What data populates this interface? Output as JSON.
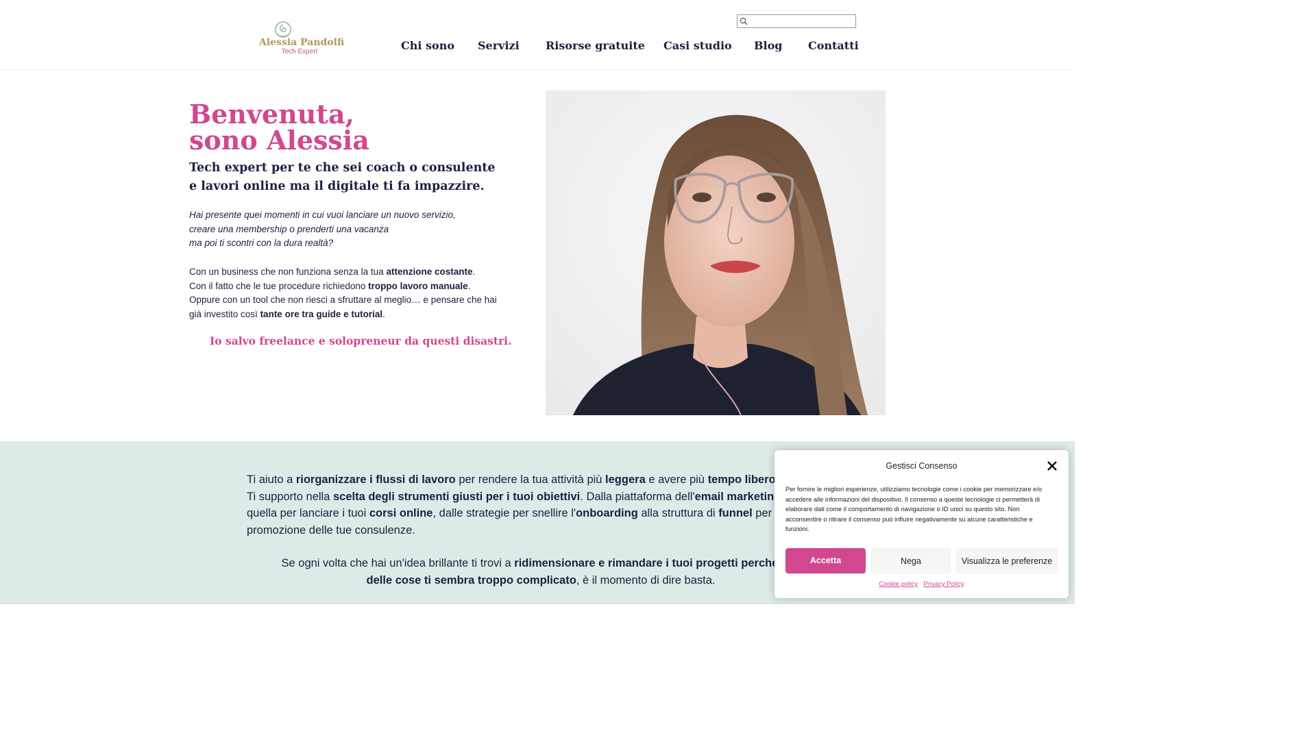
{
  "brand": {
    "name": "Alessia Pandolfi",
    "tagline": "Tech Expert",
    "gold": "#b5985a",
    "pink": "#d2478f",
    "navy": "#1b2040"
  },
  "search": {
    "placeholder": "",
    "value": ""
  },
  "nav": {
    "items": [
      "Chi sono",
      "Servizi",
      "Risorse gratuite",
      "Casi studio",
      "Blog",
      "Contatti"
    ]
  },
  "hero": {
    "title_line1": "Benvenuta,",
    "title_line2": "sono Alessia",
    "subtitle_line1": "Tech expert per te che sei coach o consulente",
    "subtitle_line2": "e lavori online ma il digitale ti fa impazzire.",
    "italic_line1": "Hai presente quei momenti in cui vuoi lanciare un nuovo servizio,",
    "italic_line2": "creare una membership o prenderti una vacanza",
    "italic_line3": "ma poi ti scontri con la dura realtà?",
    "body": {
      "l1a": "Con un business che non funziona senza la tua ",
      "l1b": "attenzione costante",
      "l1c": ".",
      "l2a": "Con il fatto che le tue procedure richiedono ",
      "l2b": "troppo lavoro manuale",
      "l2c": ".",
      "l3": "Oppure con un tool che non riesci a sfruttare al meglio… e pensare che hai",
      "l4a": "già investito così ",
      "l4b": "tante ore tra guide e tutorial",
      "l4c": "."
    },
    "tagline": "Io salvo freelance e solopreneur da questi disastri."
  },
  "band": {
    "p1": {
      "l1a": "Ti aiuto a ",
      "l1b": "riorganizzare i flussi di lavoro",
      "l1c": " per rendere la tua attività più ",
      "l1d": "leggera",
      "l1e": " e avere più ",
      "l1f": "tempo libero",
      "l2a": "Ti supporto nella ",
      "l2b": "scelta degli strumenti giusti per i tuoi obiettivi",
      "l2c": ". Dalla piattaforma dell'",
      "l2d": "email marketing",
      "l3a": "quella per lanciare i tuoi ",
      "l3b": "corsi online",
      "l3c": ", dalle strategie per snellire l'",
      "l3d": "onboarding",
      "l3e": " alla struttura di ",
      "l3f": "funnel",
      "l3g": " per",
      "l4": "promozione delle tue consulenze."
    },
    "p2": {
      "l1a": "Se ogni volta che hai un'idea brillante ti trovi a ",
      "l1b": "ridimensionare e rimandare i tuoi progetti perché il la",
      "l2a": "delle cose ti sembra troppo complicato",
      "l2b": ", è il momento di dire basta."
    },
    "background": "#ddeae7"
  },
  "consent": {
    "title": "Gestisci Consenso",
    "text_l1": "Per fornire le migliori esperienze, utilizziamo tecnologie come i cookie per memorizzare e/o",
    "text_l2": "accedere alle informazioni del dispositivo. Il consenso a queste tecnologie ci permetterà di",
    "text_l3": "elaborare dati come il comportamento di navigazione o ID unici su questo sito. Non",
    "text_l4": "acconsentire o ritirare il consenso può influire negativamente su alcune caratteristiche e",
    "text_l5": "funzioni.",
    "accept": "Accetta",
    "deny": "Nega",
    "preferences": "Visualizza le preferenze",
    "cookie_policy": "Cookie policy",
    "privacy_policy": "Privacy Policy"
  },
  "icons": {
    "search": "search-icon",
    "close": "close-icon",
    "logo": "logo-mark-icon"
  }
}
